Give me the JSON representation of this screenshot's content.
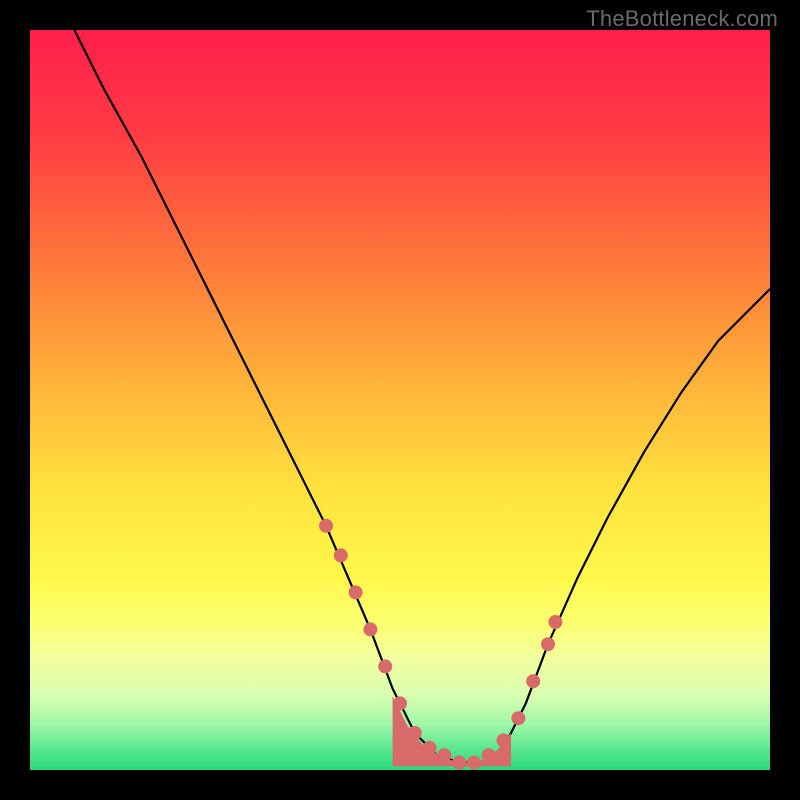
{
  "watermark": "TheBottleneck.com",
  "chart_data": {
    "type": "line",
    "title": "",
    "xlabel": "",
    "ylabel": "",
    "xlim": [
      0,
      100
    ],
    "ylim": [
      0,
      100
    ],
    "gradient_stops": [
      {
        "offset": 0,
        "color": "#ff1f4b"
      },
      {
        "offset": 14,
        "color": "#ff3b43"
      },
      {
        "offset": 32,
        "color": "#ff7a3a"
      },
      {
        "offset": 48,
        "color": "#ffb43a"
      },
      {
        "offset": 62,
        "color": "#ffe23d"
      },
      {
        "offset": 74,
        "color": "#fff84a"
      },
      {
        "offset": 80,
        "color": "#fcff6f"
      },
      {
        "offset": 85,
        "color": "#f2ffa0"
      },
      {
        "offset": 90,
        "color": "#d7ffb0"
      },
      {
        "offset": 94,
        "color": "#9cf7a8"
      },
      {
        "offset": 97,
        "color": "#5ce890"
      },
      {
        "offset": 100,
        "color": "#29d87a"
      }
    ],
    "series": [
      {
        "name": "bottleneck-curve",
        "x": [
          6,
          10,
          15,
          20,
          25,
          30,
          35,
          40,
          43,
          46,
          49,
          52,
          55,
          58,
          61,
          64,
          67,
          70,
          74,
          78,
          83,
          88,
          93,
          100
        ],
        "y": [
          100,
          92,
          83,
          73,
          63,
          53,
          43,
          33,
          26,
          19,
          11,
          5,
          2,
          1,
          1,
          3,
          9,
          17,
          26,
          34,
          43,
          51,
          58,
          65
        ]
      }
    ],
    "markers": {
      "name": "highlight-points",
      "color": "#d86a6a",
      "x": [
        40,
        42,
        44,
        46,
        48,
        50,
        52,
        54,
        56,
        58,
        60,
        62,
        64,
        66,
        68,
        70,
        71
      ],
      "y": [
        33,
        29,
        24,
        19,
        14,
        9,
        5,
        3,
        2,
        1,
        1,
        2,
        4,
        7,
        12,
        17,
        20
      ]
    },
    "blob": {
      "name": "valley-fill",
      "color": "#d86a6a",
      "points": [
        [
          49,
          10
        ],
        [
          51,
          6
        ],
        [
          53,
          3.5
        ],
        [
          55,
          2.2
        ],
        [
          57,
          1.3
        ],
        [
          59,
          1
        ],
        [
          61,
          1.3
        ],
        [
          63,
          2.5
        ],
        [
          65,
          5
        ],
        [
          65,
          0.5
        ],
        [
          49,
          0.5
        ]
      ]
    }
  }
}
